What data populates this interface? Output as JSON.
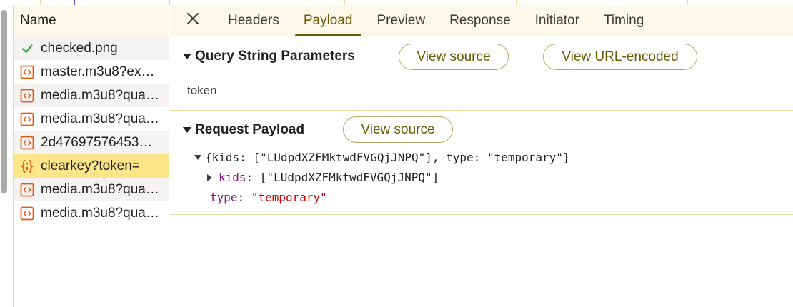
{
  "request_list": {
    "column_header": "Name",
    "items": [
      {
        "name": "checked.png",
        "icon": "checkmark-icon",
        "state": "alt"
      },
      {
        "name": "master.m3u8?ex…",
        "icon": "code-file-icon",
        "state": ""
      },
      {
        "name": "media.m3u8?qua…",
        "icon": "code-file-icon",
        "state": "alt"
      },
      {
        "name": "media.m3u8?qua…",
        "icon": "code-file-icon",
        "state": ""
      },
      {
        "name": "2d47697576453…",
        "icon": "code-file-icon",
        "state": "alt"
      },
      {
        "name": "clearkey?token=",
        "icon": "json-braces-icon",
        "state": "selected"
      },
      {
        "name": "media.m3u8?qua…",
        "icon": "code-file-icon",
        "state": "alt"
      },
      {
        "name": "media.m3u8?qua…",
        "icon": "code-file-icon",
        "state": ""
      }
    ]
  },
  "tabs": {
    "close_icon": "close-icon",
    "items": [
      "Headers",
      "Payload",
      "Preview",
      "Response",
      "Initiator",
      "Timing"
    ],
    "active": "Payload"
  },
  "query_section": {
    "title": "Query String Parameters",
    "view_source": "View source",
    "view_url_encoded": "View URL-encoded",
    "param_key": "token"
  },
  "payload_section": {
    "title": "Request Payload",
    "view_source": "View source",
    "summary": "{kids: [\"LUdpdXZFMktwdFVGQjJNPQ\"], type: \"temporary\"}",
    "kids_key": "kids",
    "kids_value": "[\"LUdpdXZFMktwdFVGQjJNPQ\"]",
    "type_key": "type",
    "type_value": "\"temporary\""
  },
  "colors": {
    "accent": "#6b5a00",
    "selected_row": "#fde68a",
    "border": "#e6dba0",
    "icon_orange": "#e8590c",
    "check_green": "#2ea043"
  }
}
